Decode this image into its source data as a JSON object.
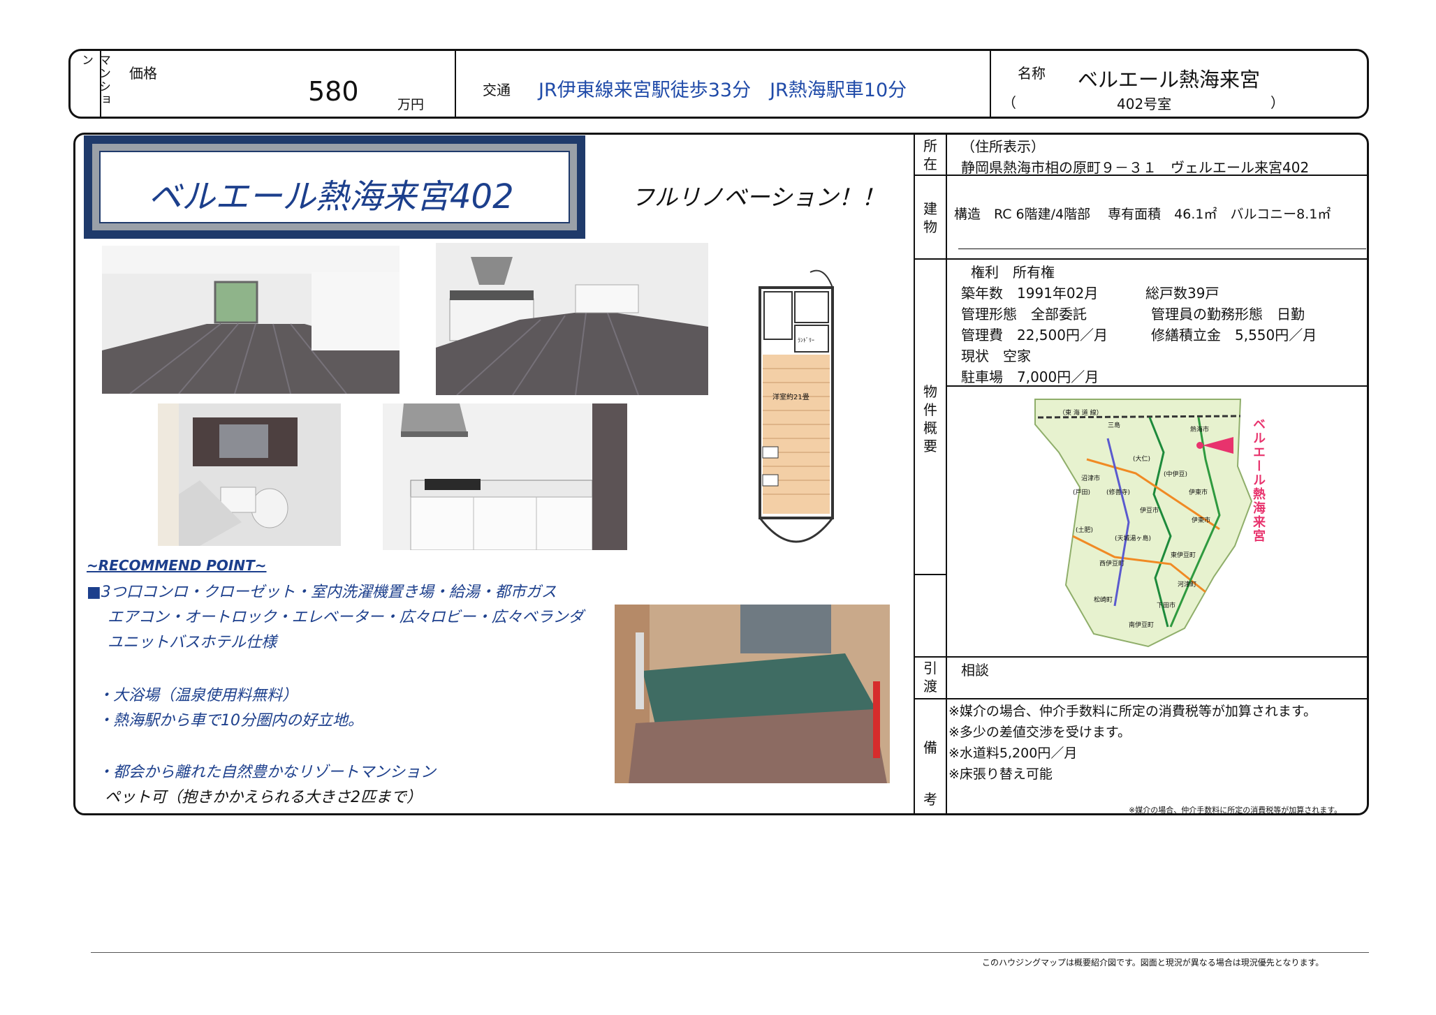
{
  "header": {
    "type_label": "マンション",
    "price_label": "価格",
    "price_value": "580",
    "price_unit": "万円",
    "access_label": "交通",
    "access_value": "JR伊東線来宮駅徒歩33分　JR熱海駅車10分",
    "name_label": "名称",
    "name_value": "ベルエール熱海来宮",
    "room_open": "（",
    "room_value": "402号室",
    "room_close": "）"
  },
  "title_box": {
    "text": "ベルエール熱海来宮402"
  },
  "catch": "フルリノベーション！！",
  "recommend": {
    "heading": "~RECOMMEND POINT~",
    "lines": [
      "■3つ口コンロ・クローゼット・室内洗濯機置き場・給湯・都市ガス",
      "エアコン・オートロック・エレベーター・広々ロビー・広々ベランダ",
      "ユニットバスホテル仕様",
      "・大浴場（温泉使用料無料）",
      "・熱海駅から車で10分圏内の好立地。",
      "・都会から離れた自然豊かなリゾートマンション",
      "ペット可（抱きかかえられる大きさ2匹まで）"
    ]
  },
  "floorplan": {
    "room_label": "洋室約21畳",
    "unit_label": "ﾗﾝﾄﾞﾘｰ"
  },
  "address": {
    "label": "所在",
    "note": "（住所表示）",
    "value": "静岡県熱海市相の原町９－３１　ヴェルエール来宮402"
  },
  "building": {
    "label": "建物",
    "value": "構造　RC 6階建/4階部　 専有面積　46.1㎡　バルコニー8.1㎡"
  },
  "property": {
    "label": "物件概要",
    "rights": "権利　所有権",
    "built_year": "築年数　1991年02月",
    "total_units": "総戸数39戸",
    "management": "管理形態　全部委託",
    "manager_work": "管理員の勤務形態　日勤",
    "management_fee": "管理費　22,500円／月",
    "repair_fund": "修繕積立金　5,550円／月",
    "status": "現状　空家",
    "parking": "駐車場　7,000円／月"
  },
  "map": {
    "marker_label": "ベルエール熱海来宮",
    "region_label": "（東 海 道 線）",
    "labels": [
      "伊豆市",
      "伊東市",
      "伊東市",
      "西伊豆町",
      "東伊豆町",
      "松崎町",
      "河津町",
      "下田市",
      "南伊豆町",
      "沼津市",
      "熱海市",
      "三島",
      "(修善寺)",
      "(中伊豆)",
      "(天城湯ヶ島)",
      "(土肥)",
      "(戸田)",
      "(大仁)"
    ]
  },
  "delivery": {
    "label": "引渡",
    "value": "相談"
  },
  "remarks": {
    "label": "備考",
    "lines": [
      "※媒介の場合、仲介手数料に所定の消費税等が加算されます。",
      "※多少の差値交渉を受けます。",
      "※水道料5,200円／月",
      "※床張り替え可能"
    ],
    "small_note": "※媒介の場合、仲介手数料に所定の消費税等が加算されます。"
  },
  "footer": {
    "note": "このハウジングマップは概要紹介図です。図面と現況が異なる場合は現況優先となります。"
  },
  "colors": {
    "title_navy": "#1f3a6b",
    "title_text": "#1c3f8c",
    "access_blue": "#1f4aa8",
    "map_marker": "#e8336d"
  }
}
